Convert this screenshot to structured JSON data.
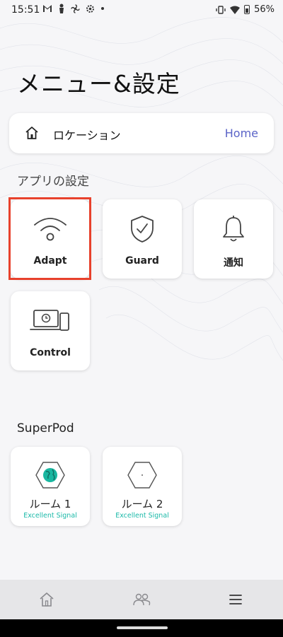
{
  "status_bar": {
    "time": "15:51",
    "battery": "56%",
    "left_icons": [
      "gmail-icon",
      "figure-icon",
      "fan-icon",
      "settings-icon",
      "dot-icon"
    ],
    "right_icons": [
      "vibrate-icon",
      "wifi-icon",
      "battery-icon"
    ]
  },
  "page_title": "メニュー&設定",
  "location": {
    "label": "ロケーション",
    "value": "Home"
  },
  "app_settings": {
    "title": "アプリの設定",
    "tiles": [
      {
        "label": "Adapt",
        "icon": "wifi-icon"
      },
      {
        "label": "Guard",
        "icon": "shield-check-icon"
      },
      {
        "label": "通知",
        "icon": "bell-icon"
      },
      {
        "label": "Control",
        "icon": "laptop-phone-clock-icon"
      }
    ]
  },
  "superpod": {
    "title": "SuperPod",
    "pods": [
      {
        "name": "ルーム 1",
        "signal": "Excellent Signal",
        "icon": "pod-hexagon-globe-icon"
      },
      {
        "name": "ルーム 2",
        "signal": "Excellent Signal",
        "icon": "pod-hexagon-icon"
      }
    ]
  },
  "bottom_nav": {
    "items": [
      {
        "icon": "home-icon"
      },
      {
        "icon": "people-icon"
      },
      {
        "icon": "menu-icon"
      }
    ]
  },
  "colors": {
    "accent": "#5a63c7",
    "highlight_border": "#e8412c",
    "signal": "#1ab9a8",
    "pod_globe": "#19b7a0"
  }
}
